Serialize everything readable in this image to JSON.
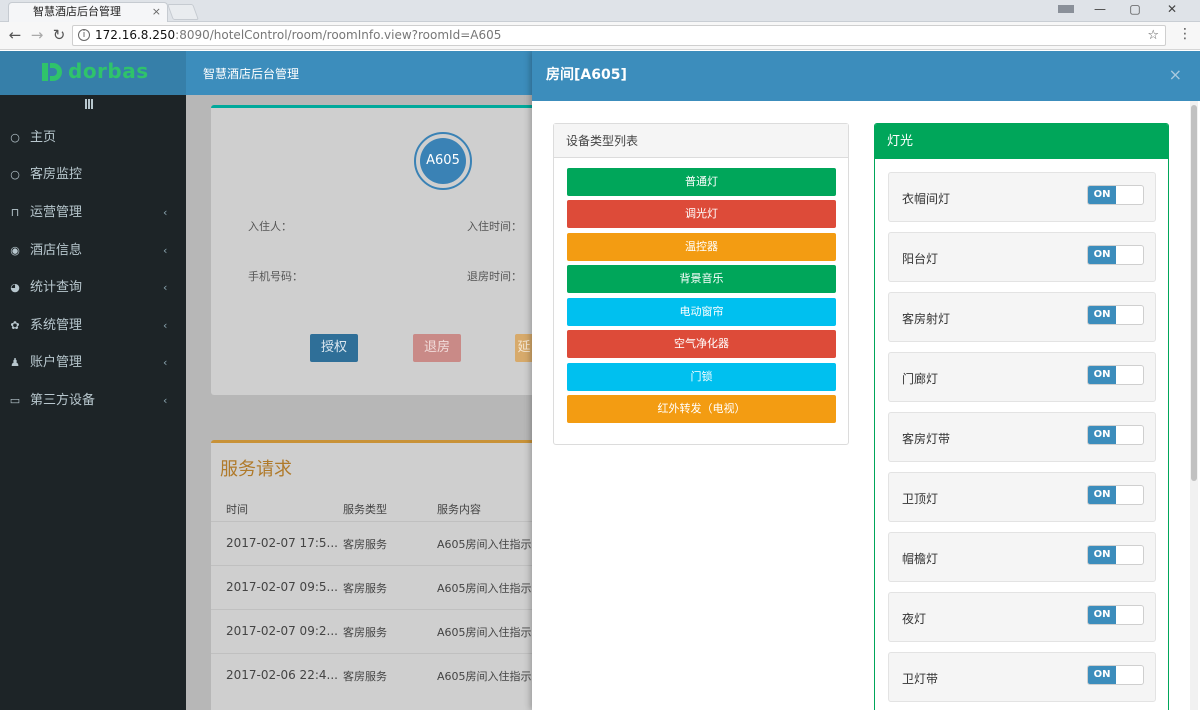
{
  "browser": {
    "tab_title": "智慧酒店后台管理",
    "tab_close": "×",
    "url_host": "172.16.8.250",
    "url_path": ":8090/hotelControl/room/roomInfo.view?roomId=A605",
    "window_min": "—",
    "window_max": "▢",
    "window_close": "✕"
  },
  "app": {
    "logo_text": "dorbas",
    "title": "智慧酒店后台管理",
    "colors": {
      "header": "#3c8dbc",
      "sidebar": "#1d2427",
      "accent_green": "#00a65a"
    }
  },
  "sidebar": {
    "items": [
      {
        "label": "主页",
        "icon": "circle-icon",
        "has_caret": false
      },
      {
        "label": "客房监控",
        "icon": "circle-icon",
        "has_caret": false
      },
      {
        "label": "运营管理",
        "icon": "bookmark-icon",
        "has_caret": true
      },
      {
        "label": "酒店信息",
        "icon": "eye-icon",
        "has_caret": true
      },
      {
        "label": "统计查询",
        "icon": "pie-chart-icon",
        "has_caret": true
      },
      {
        "label": "系统管理",
        "icon": "gear-icon",
        "has_caret": true
      },
      {
        "label": "账户管理",
        "icon": "user-icon",
        "has_caret": true
      },
      {
        "label": "第三方设备",
        "icon": "monitor-icon",
        "has_caret": true
      }
    ]
  },
  "room_info": {
    "room_no": "A605",
    "guest_label": "入住人：",
    "checkin_label": "入住时间：",
    "phone_label": "手机号码：",
    "checkout_label": "退房时间：",
    "authorize_button": "授权",
    "checkout_button": "退房",
    "third_button_partial": "延"
  },
  "service_requests": {
    "title": "服务请求",
    "columns": [
      "时间",
      "服务类型",
      "服务内容"
    ],
    "rows": [
      {
        "time": "2017-02-07 17:5...",
        "type": "客房服务",
        "content": "A605房间入住指示"
      },
      {
        "time": "2017-02-07 09:5...",
        "type": "客房服务",
        "content": "A605房间入住指示"
      },
      {
        "time": "2017-02-07 09:2...",
        "type": "客房服务",
        "content": "A605房间入住指示"
      },
      {
        "time": "2017-02-06 22:4...",
        "type": "客房服务",
        "content": "A605房间入住指示"
      }
    ]
  },
  "modal": {
    "title": "房间[A605]",
    "close": "×",
    "device_panel_title": "设备类型列表",
    "device_types": [
      {
        "label": "普通灯",
        "color": "#00a65a"
      },
      {
        "label": "调光灯",
        "color": "#dd4b39"
      },
      {
        "label": "温控器",
        "color": "#f39c12"
      },
      {
        "label": "背景音乐",
        "color": "#00a65a"
      },
      {
        "label": "电动窗帘",
        "color": "#00c0ef"
      },
      {
        "label": "空气净化器",
        "color": "#dd4b39"
      },
      {
        "label": "门锁",
        "color": "#00c0ef"
      },
      {
        "label": "红外转发（电视）",
        "color": "#f39c12"
      }
    ],
    "light_panel_title": "灯光",
    "lights": [
      {
        "name": "衣帽间灯",
        "state": "ON"
      },
      {
        "name": "阳台灯",
        "state": "ON"
      },
      {
        "name": "客房射灯",
        "state": "ON"
      },
      {
        "name": "门廊灯",
        "state": "ON"
      },
      {
        "name": "客房灯带",
        "state": "ON"
      },
      {
        "name": "卫顶灯",
        "state": "ON"
      },
      {
        "name": "帽檐灯",
        "state": "ON"
      },
      {
        "name": "夜灯",
        "state": "ON"
      },
      {
        "name": "卫灯带",
        "state": "ON"
      }
    ]
  }
}
